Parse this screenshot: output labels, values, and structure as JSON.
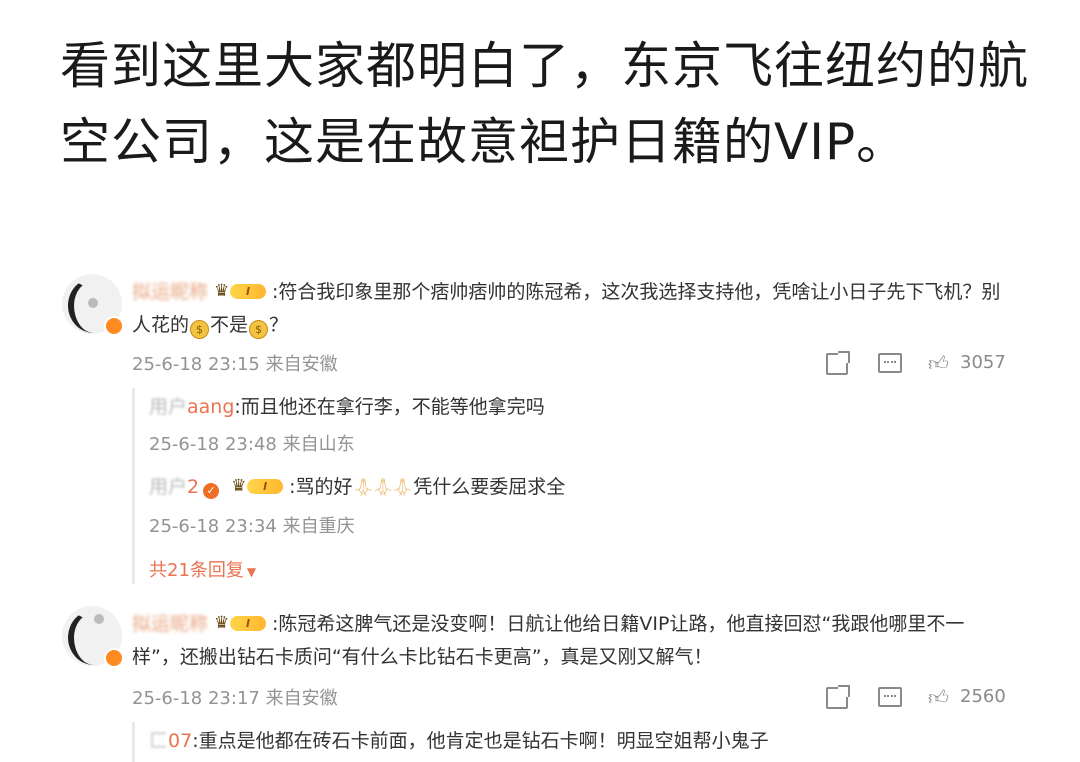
{
  "headline": "看到这里大家都明白了，东京飞往纽约的航空公司，这是在故意袒护日籍的VIP。",
  "rank_label": "I",
  "comments": [
    {
      "username": "拟运昵称",
      "text_part1": ":符合我印象里那个痞帅痞帅的陈冠希，这次我选择支持他，凭啥让小日子先下飞机？别人花的",
      "text_part2": "不是",
      "text_part3": "？",
      "time": "25-6-18 23:15 来自安徽",
      "likes": "3057",
      "replies": [
        {
          "username": "用户",
          "username_tail": "aang",
          "text": ":而且他还在拿行李，不能等他拿完吗",
          "time": "25-6-18 23:48 来自山东"
        },
        {
          "username": "用户",
          "username_tail": "2",
          "text": ":骂的好",
          "text_after": "凭什么要委屈求全",
          "time": "25-6-18 23:34 来自重庆"
        }
      ],
      "more_replies": "共21条回复"
    },
    {
      "username": "拟运昵称",
      "text": ":陈冠希这脾气还是没变啊！日航让他给日籍VIP让路，他直接回怼“我跟他哪里不一样”，还搬出钻石卡质问“有什么卡比钻石卡更高”，真是又刚又解气！",
      "time": "25-6-18 23:17 来自安徽",
      "likes": "2560",
      "replies": [
        {
          "username": "匚",
          "username_tail": "07",
          "text": ":重点是他都在砖石卡前面，他肯定也是钻石卡啊！明显空姐帮小鬼子"
        }
      ]
    }
  ]
}
